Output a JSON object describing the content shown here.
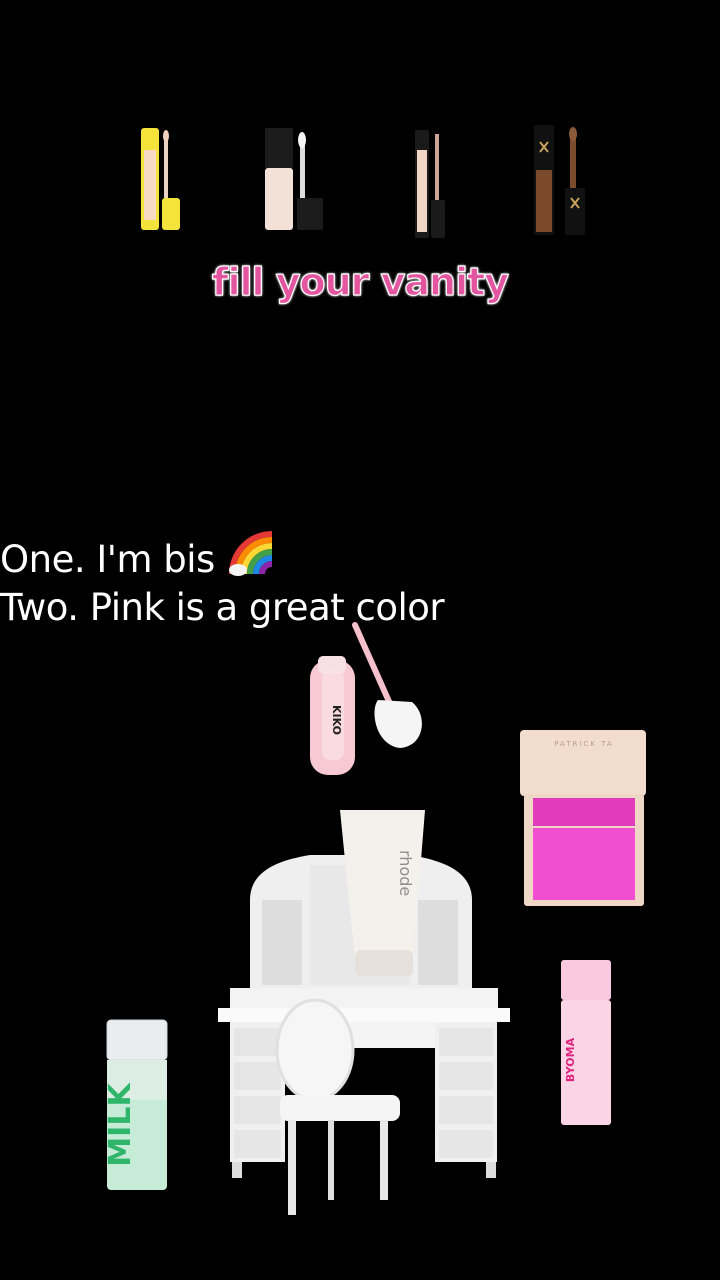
{
  "overlay_title": "fill your vanity",
  "caption": {
    "line1": "One. I'm bis",
    "line1_emoji": "rainbow-emoji",
    "line2": "Two. Pink is a great color"
  },
  "products": {
    "kiko_gloss_brand": "KIKO",
    "rhode_tube_brand": "rhode",
    "byoma_brand": "BYOMA",
    "milk_brand": "MILK",
    "patrick_ta_brand": "PATRICK TA"
  },
  "colors": {
    "title_pink": "#e3559f",
    "blush_pink": "#f03fc5",
    "background": "#000000"
  }
}
